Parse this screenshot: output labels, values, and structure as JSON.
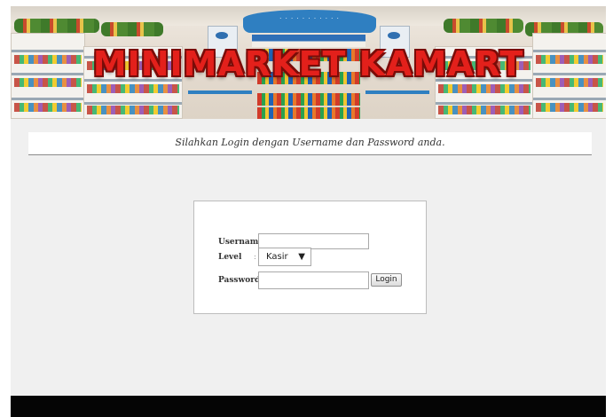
{
  "banner": {
    "title": "MINIMARKET KAMART"
  },
  "message": {
    "text": "Silahkan Login dengan Username dan Password anda."
  },
  "login": {
    "username_label": "Username",
    "level_label": "Level",
    "password_label": "Password",
    "colon": ":",
    "username_value": "",
    "password_value": "",
    "level_selected": "Kasir",
    "login_button": "Login"
  },
  "icons": {
    "select_arrow": "chevron-down-icon"
  }
}
